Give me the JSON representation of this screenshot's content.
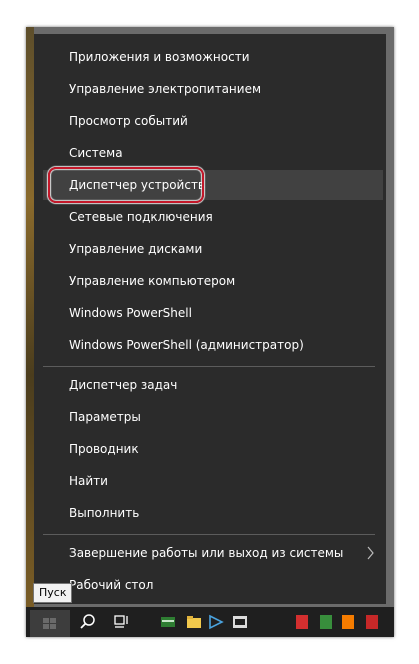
{
  "menu": {
    "items": [
      {
        "label": "Приложения и возможности"
      },
      {
        "label": "Управление электропитанием"
      },
      {
        "label": "Просмотр событий"
      },
      {
        "label": "Система"
      },
      {
        "label": "Диспетчер устройств"
      },
      {
        "label": "Сетевые подключения"
      },
      {
        "label": "Управление дисками"
      },
      {
        "label": "Управление компьютером"
      },
      {
        "label": "Windows PowerShell"
      },
      {
        "label": "Windows PowerShell (администратор)"
      },
      {
        "label": "Диспетчер задач"
      },
      {
        "label": "Параметры"
      },
      {
        "label": "Проводник"
      },
      {
        "label": "Найти"
      },
      {
        "label": "Выполнить"
      },
      {
        "label": "Завершение работы или выход из системы"
      },
      {
        "label": "Рабочий стол"
      }
    ],
    "highlighted_item": "Диспетчер устройств",
    "highlight_color": "#c4182a",
    "background_color": "#2b2b2b"
  },
  "tooltip": {
    "text": "Пуск"
  },
  "taskbar": {
    "icons": [
      "windows-start-icon",
      "search-icon",
      "task-view-icon",
      "app-icon",
      "folder-icon",
      "code-icon",
      "app-icon",
      "red-app-icon",
      "green-app-icon",
      "orange-app-icon",
      "red-app-icon"
    ]
  }
}
